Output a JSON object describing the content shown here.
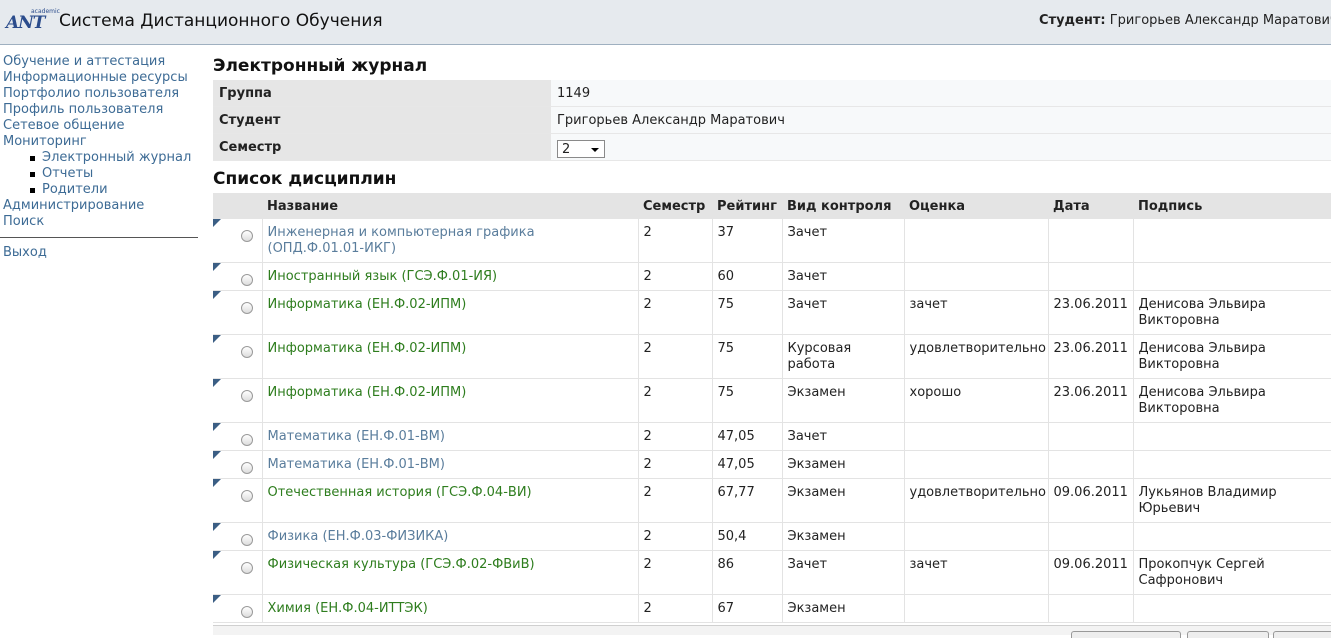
{
  "header": {
    "app_title": "Система Дистанционного Обучения",
    "logo_text": "ANT",
    "logo_small": "academic",
    "user_label": "Студент:",
    "user_name": "Григорьев Александр Маратович"
  },
  "sidebar": {
    "items": [
      {
        "label": "Обучение и аттестация"
      },
      {
        "label": "Информационные ресурсы"
      },
      {
        "label": "Портфолио пользователя"
      },
      {
        "label": "Профиль пользователя"
      },
      {
        "label": "Сетевое общение"
      },
      {
        "label": "Мониторинг"
      }
    ],
    "subitems": [
      {
        "label": "Электронный журнал"
      },
      {
        "label": "Отчеты"
      },
      {
        "label": "Родители"
      }
    ],
    "admin": "Администрирование",
    "search": "Поиск",
    "logout": "Выход"
  },
  "journal": {
    "title": "Электронный журнал",
    "group_label": "Группа",
    "group_value": "1149",
    "student_label": "Студент",
    "student_value": "Григорьев Александр Маратович",
    "semester_label": "Семестр",
    "semester_value": "2"
  },
  "disciplines": {
    "title": "Список дисциплин",
    "headers": {
      "name": "Название",
      "semester": "Семестр",
      "rating": "Рейтинг",
      "control": "Вид контроля",
      "grade": "Оценка",
      "date": "Дата",
      "signature": "Подпись"
    },
    "rows": [
      {
        "name": "Инженерная и компьютерная графика (ОПД.Ф.01.01-ИКГ)",
        "semester": "2",
        "rating": "37",
        "control": "Зачет",
        "grade": "",
        "date": "",
        "signature": "",
        "style": "grey"
      },
      {
        "name": "Иностранный язык (ГСЭ.Ф.01-ИЯ)",
        "semester": "2",
        "rating": "60",
        "control": "Зачет",
        "grade": "",
        "date": "",
        "signature": "",
        "style": "green"
      },
      {
        "name": "Информатика (ЕН.Ф.02-ИПМ)",
        "semester": "2",
        "rating": "75",
        "control": "Зачет",
        "grade": "зачет",
        "date": "23.06.2011",
        "signature": "Денисова Эльвира Викторовна",
        "style": "green"
      },
      {
        "name": "Информатика (ЕН.Ф.02-ИПМ)",
        "semester": "2",
        "rating": "75",
        "control": "Курсовая работа",
        "grade": "удовлетворительно",
        "date": "23.06.2011",
        "signature": "Денисова Эльвира Викторовна",
        "style": "green"
      },
      {
        "name": "Информатика (ЕН.Ф.02-ИПМ)",
        "semester": "2",
        "rating": "75",
        "control": "Экзамен",
        "grade": "хорошо",
        "date": "23.06.2011",
        "signature": "Денисова Эльвира Викторовна",
        "style": "green"
      },
      {
        "name": "Математика (ЕН.Ф.01-ВМ)",
        "semester": "2",
        "rating": "47,05",
        "control": "Зачет",
        "grade": "",
        "date": "",
        "signature": "",
        "style": "grey"
      },
      {
        "name": "Математика (ЕН.Ф.01-ВМ)",
        "semester": "2",
        "rating": "47,05",
        "control": "Экзамен",
        "grade": "",
        "date": "",
        "signature": "",
        "style": "grey"
      },
      {
        "name": "Отечественная история (ГСЭ.Ф.04-ВИ)",
        "semester": "2",
        "rating": "67,77",
        "control": "Экзамен",
        "grade": "удовлетворительно",
        "date": "09.06.2011",
        "signature": "Лукьянов Владимир Юрьевич",
        "style": "green"
      },
      {
        "name": "Физика (ЕН.Ф.03-ФИЗИКА)",
        "semester": "2",
        "rating": "50,4",
        "control": "Экзамен",
        "grade": "",
        "date": "",
        "signature": "",
        "style": "grey"
      },
      {
        "name": "Физическая культура (ГСЭ.Ф.02-ФВиВ)",
        "semester": "2",
        "rating": "86",
        "control": "Зачет",
        "grade": "зачет",
        "date": "09.06.2011",
        "signature": "Прокопчук Сергей Сафронович",
        "style": "green"
      },
      {
        "name": "Химия (ЕН.Ф.04-ИТТЭК)",
        "semester": "2",
        "rating": "67",
        "control": "Экзамен",
        "grade": "",
        "date": "",
        "signature": "",
        "style": "green"
      }
    ]
  },
  "colors": {
    "header_bg": "#e6eaee",
    "link": "#3d6b95",
    "passed_link": "#2e7d1e",
    "pending_link": "#5a7d9c",
    "row_marker": "#3b5e84"
  }
}
